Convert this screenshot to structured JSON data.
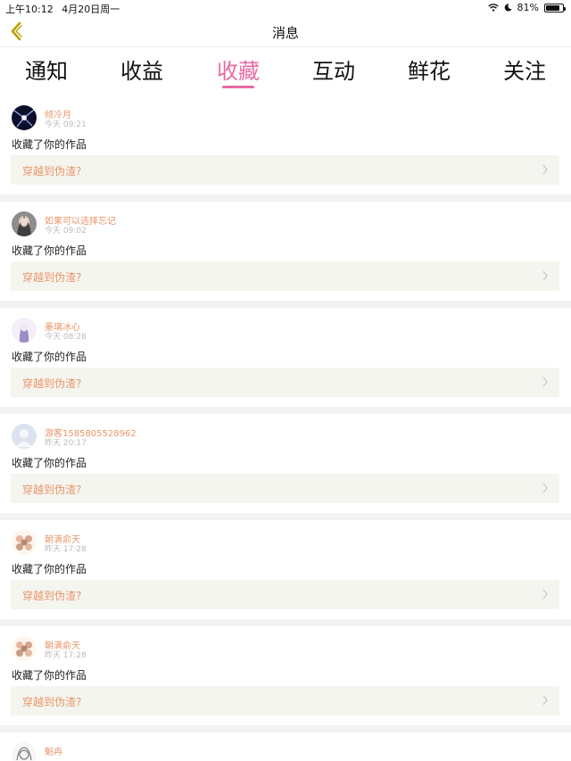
{
  "status": {
    "time": "上午10:12",
    "date": "4月20日周一",
    "battery": "81%",
    "battery_level": 0.81
  },
  "nav": {
    "title": "消息"
  },
  "tabs": [
    {
      "label": "通知"
    },
    {
      "label": "收益"
    },
    {
      "label": "收藏"
    },
    {
      "label": "互动"
    },
    {
      "label": "鲜花"
    },
    {
      "label": "关注"
    }
  ],
  "active_tab": "收藏",
  "colors": {
    "accent": "#e86aa3",
    "name": "#e8956a",
    "work_bg": "#f5f5ef"
  },
  "items": [
    {
      "user": "倾冷月",
      "time": "今天 09:21",
      "action": "收藏了你的作品",
      "work": "穿越到伪渣?"
    },
    {
      "user": "如果可以选择忘记",
      "time": "今天 09:02",
      "action": "收藏了你的作品",
      "work": "穿越到伪渣?"
    },
    {
      "user": "墨璃冰心",
      "time": "今天 08:28",
      "action": "收藏了你的作品",
      "work": "穿越到伪渣?"
    },
    {
      "user": "游客1585805528962",
      "time": "昨天 20:17",
      "action": "收藏了你的作品",
      "work": "穿越到伪渣?"
    },
    {
      "user": "朝满俞天",
      "time": "昨天 17:28",
      "action": "收藏了你的作品",
      "work": "穿越到伪渣?"
    },
    {
      "user": "朝满俞天",
      "time": "昨天 17:28",
      "action": "收藏了你的作品",
      "work": "穿越到伪渣?"
    }
  ],
  "partial_item": {
    "user": "魁冉"
  }
}
